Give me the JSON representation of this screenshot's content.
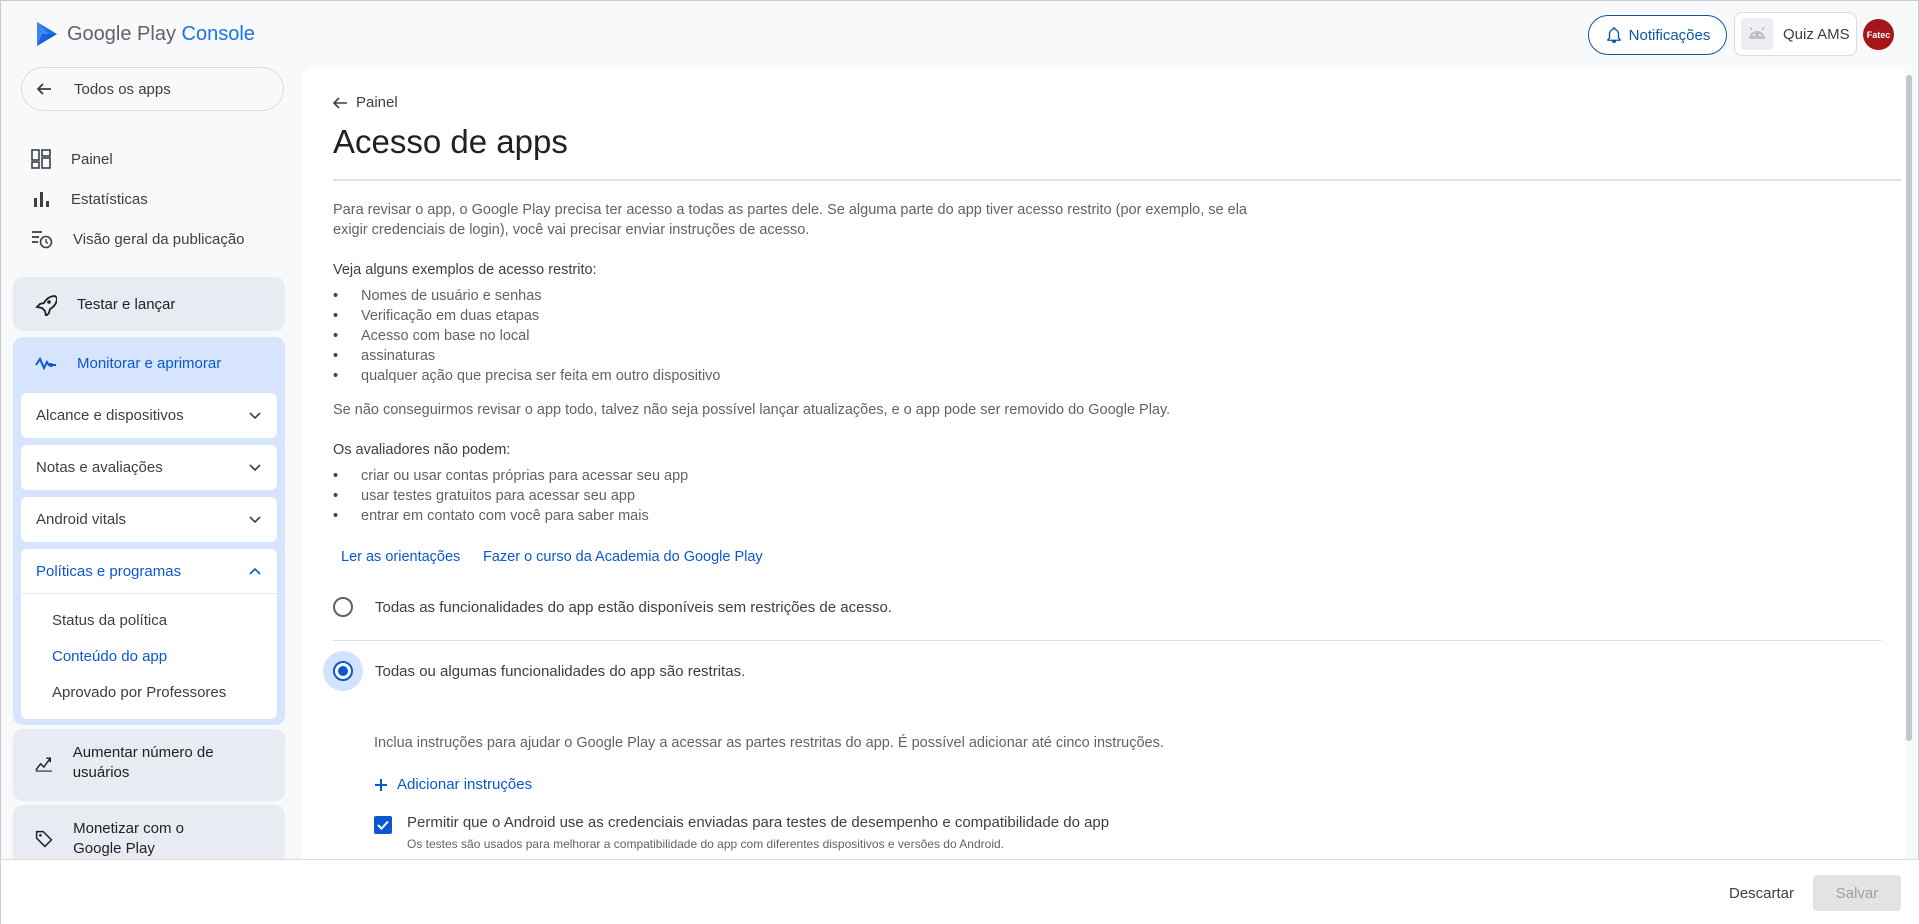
{
  "header": {
    "logo_google_play": "Google Play",
    "logo_console": "Console",
    "notifications_label": "Notificações",
    "app_name": "Quiz AMS",
    "avatar_text": "Fatec"
  },
  "sidebar": {
    "all_apps_label": "Todos os apps",
    "items": [
      {
        "label": "Painel",
        "icon": "dashboard-icon"
      },
      {
        "label": "Estatísticas",
        "icon": "bar-chart-icon"
      },
      {
        "label": "Visão geral da publicação",
        "icon": "publishing-overview-icon"
      }
    ],
    "test_release": "Testar e lançar",
    "monitor_improve": "Monitorar e aprimorar",
    "subgroups": [
      {
        "label": "Alcance e dispositivos"
      },
      {
        "label": "Notas e avaliações"
      },
      {
        "label": "Android vitals"
      }
    ],
    "policies_label": "Políticas e programas",
    "policies_children": [
      "Status da política",
      "Conteúdo do app",
      "Aprovado por Professores"
    ],
    "grow_users": "Aumentar número de usuários",
    "monetize": "Monetizar com o Google Play"
  },
  "main": {
    "back_label": "Painel",
    "title": "Acesso de apps",
    "intro_1": "Para revisar o app, o Google Play precisa ter acesso a todas as partes dele. Se alguma parte do app tiver acesso restrito (por exemplo, se ela",
    "intro_2": "exigir credenciais de login), você vai precisar enviar instruções de acesso.",
    "examples_heading": "Veja alguns exemplos de acesso restrito:",
    "examples": [
      "Nomes de usuário e senhas",
      "Verificação em duas etapas",
      "Acesso com base no local",
      "assinaturas",
      "qualquer ação que precisa ser feita em outro dispositivo"
    ],
    "warning": "Se não conseguirmos revisar o app todo, talvez não seja possível lançar atualizações, e o app pode ser removido do Google Play.",
    "reviewers_heading": "Os avaliadores não podem:",
    "reviewers": [
      "criar ou usar contas próprias para acessar seu app",
      "usar testes gratuitos para acessar seu app",
      "entrar em contato com você para saber mais"
    ],
    "link_guidelines": "Ler as orientações",
    "link_course": "Fazer o curso da Academia do Google Play",
    "option_all": "Todas as funcionalidades do app estão disponíveis sem restrições de acesso.",
    "option_restricted": "Todas ou algumas funcionalidades do app são restritas.",
    "selected_option": "restricted",
    "instructions_help": "Inclua instruções para ajudar o Google Play a acessar as partes restritas do app. É possível adicionar até cinco instruções.",
    "add_instructions": "Adicionar instruções",
    "checkbox_label": "Permitir que o Android use as credenciais enviadas para testes de desempenho e compatibilidade do app",
    "checkbox_checked": true,
    "checkbox_help": "Os testes são usados para melhorar a compatibilidade do app com diferentes dispositivos e versões do Android."
  },
  "footer": {
    "discard_label": "Descartar",
    "save_label": "Salvar"
  },
  "colors": {
    "accent": "#0b57d0",
    "active_group_bg": "#d6e4fd"
  }
}
